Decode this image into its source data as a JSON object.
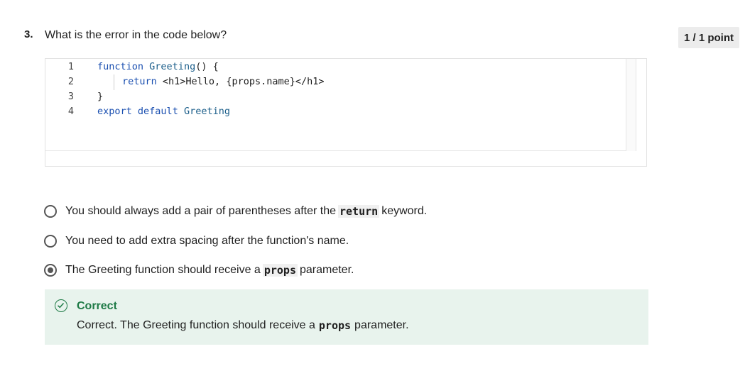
{
  "question": {
    "number": "3.",
    "text": "What is the error in the code below?",
    "points": "1 / 1 point"
  },
  "code": {
    "lines": [
      {
        "num": "1",
        "parts": [
          "function",
          " ",
          "Greeting",
          "() {"
        ]
      },
      {
        "num": "2",
        "parts": [
          "return",
          " <h1>Hello, {props.name}</h1>"
        ]
      },
      {
        "num": "3",
        "parts": [
          "}"
        ]
      },
      {
        "num": "4",
        "parts": [
          "export",
          " ",
          "default",
          " ",
          "Greeting"
        ]
      }
    ]
  },
  "options": [
    {
      "before": "You should always add a pair of parentheses after the",
      "code": "return",
      "after": "keyword.",
      "selected": false
    },
    {
      "before": "You need to add extra spacing after the function's name.",
      "code": "",
      "after": "",
      "selected": false
    },
    {
      "before": "The Greeting function should receive a",
      "code": "props",
      "after": "parameter.",
      "selected": true
    }
  ],
  "feedback": {
    "title": "Correct",
    "before": "Correct. The Greeting function should receive a",
    "code": "props",
    "after": "parameter."
  },
  "colors": {
    "correct_green": "#1e7a46",
    "feedback_bg": "#e8f3ed",
    "keyword_blue": "#1a4fb0"
  }
}
